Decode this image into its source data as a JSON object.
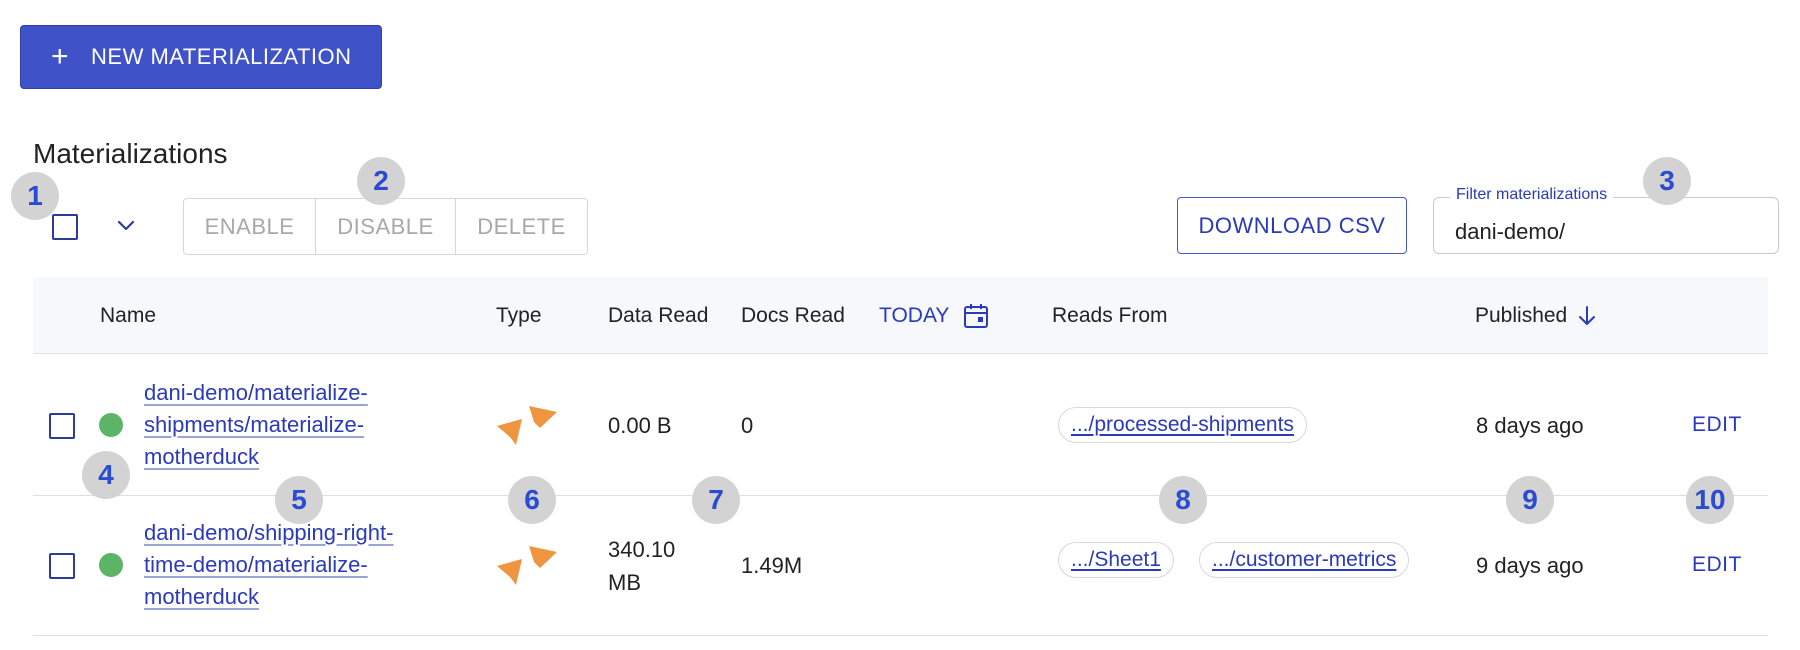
{
  "toolbar": {
    "new_button_label": "NEW MATERIALIZATION",
    "page_title": "Materializations",
    "enable_label": "ENABLE",
    "disable_label": "DISABLE",
    "delete_label": "DELETE",
    "download_csv_label": "DOWNLOAD CSV"
  },
  "filter": {
    "label": "Filter materializations",
    "value": "dani-demo/"
  },
  "table": {
    "columns": {
      "name": "Name",
      "type": "Type",
      "data_read": "Data Read",
      "docs_read": "Docs Read",
      "range": "TODAY",
      "reads_from": "Reads From",
      "published": "Published"
    },
    "rows": [
      {
        "name_lines": [
          "dani-demo/materialize-",
          "shipments/materialize-",
          "motherduck"
        ],
        "status": "enabled",
        "type_icon": "motherduck-icon",
        "data_read_lines": [
          "0.00 B"
        ],
        "docs_read": "0",
        "reads_from": [
          ".../processed-shipments"
        ],
        "published": "8 days ago",
        "edit_label": "EDIT"
      },
      {
        "name_lines": [
          "dani-demo/shipping-right-",
          "time-demo/materialize-",
          "motherduck"
        ],
        "status": "enabled",
        "type_icon": "motherduck-icon",
        "data_read_lines": [
          "340.10",
          "MB"
        ],
        "docs_read": "1.49M",
        "reads_from": [
          ".../Sheet1",
          ".../customer-metrics"
        ],
        "published": "9 days ago",
        "edit_label": "EDIT"
      }
    ]
  },
  "markers": [
    "1",
    "2",
    "3",
    "4",
    "5",
    "6",
    "7",
    "8",
    "9",
    "10"
  ],
  "colors": {
    "primary": "#4052c8",
    "link": "#2a3ab8",
    "status_ok": "#5cb567",
    "type_icon": "#f0953f",
    "marker_bg": "#d3d3d3"
  }
}
